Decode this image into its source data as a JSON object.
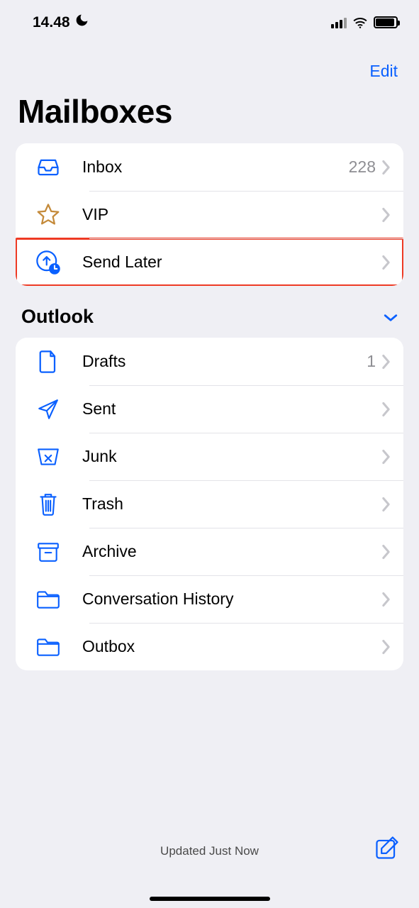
{
  "status_bar": {
    "time": "14.48"
  },
  "header": {
    "edit": "Edit",
    "title": "Mailboxes"
  },
  "mailboxes": [
    {
      "icon": "inbox-icon",
      "label": "Inbox",
      "count": "228",
      "highlight": false
    },
    {
      "icon": "star-icon",
      "label": "VIP",
      "count": "",
      "highlight": false
    },
    {
      "icon": "clock-up-icon",
      "label": "Send Later",
      "count": "",
      "highlight": true
    }
  ],
  "account_section": {
    "title": "Outlook"
  },
  "account_folders": [
    {
      "icon": "document-icon",
      "label": "Drafts",
      "count": "1"
    },
    {
      "icon": "paperplane-icon",
      "label": "Sent",
      "count": ""
    },
    {
      "icon": "junk-icon",
      "label": "Junk",
      "count": ""
    },
    {
      "icon": "trash-icon",
      "label": "Trash",
      "count": ""
    },
    {
      "icon": "archive-icon",
      "label": "Archive",
      "count": ""
    },
    {
      "icon": "folder-icon",
      "label": "Conversation History",
      "count": ""
    },
    {
      "icon": "folder-icon",
      "label": "Outbox",
      "count": ""
    }
  ],
  "bottom": {
    "status": "Updated Just Now"
  }
}
